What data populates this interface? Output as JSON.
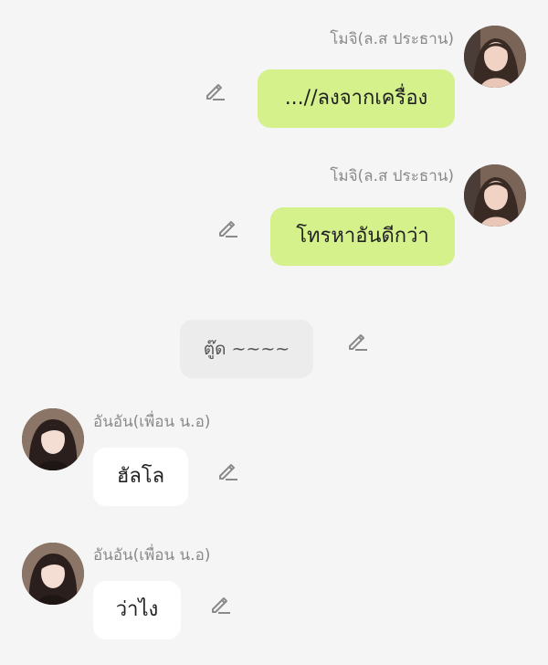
{
  "messages": [
    {
      "sender": "โมจิ(ล.ส ประธาน)",
      "text": "...//ลงจากเครื่อง",
      "side": "outgoing"
    },
    {
      "sender": "โมจิ(ล.ส ประธาน)",
      "text": "โทรหาอันดีกว่า",
      "side": "outgoing"
    },
    {
      "text": "ตู๊ด ~~~~",
      "side": "call"
    },
    {
      "sender": "อันอัน(เพื่อน น.อ)",
      "text": "ฮัลโล",
      "side": "incoming"
    },
    {
      "sender": "อันอัน(เพื่อน น.อ)",
      "text": "ว่าไง",
      "side": "incoming"
    }
  ],
  "icons": {
    "edit": "pencil-edit-icon",
    "avatar_mochi": "avatar-mochi",
    "avatar_anan": "avatar-anan"
  },
  "colors": {
    "background": "#f5f5f5",
    "outgoing_bubble": "#d4f18c",
    "incoming_bubble": "#ffffff",
    "call_bubble": "#ececec",
    "name_text": "#8a8a8a"
  }
}
